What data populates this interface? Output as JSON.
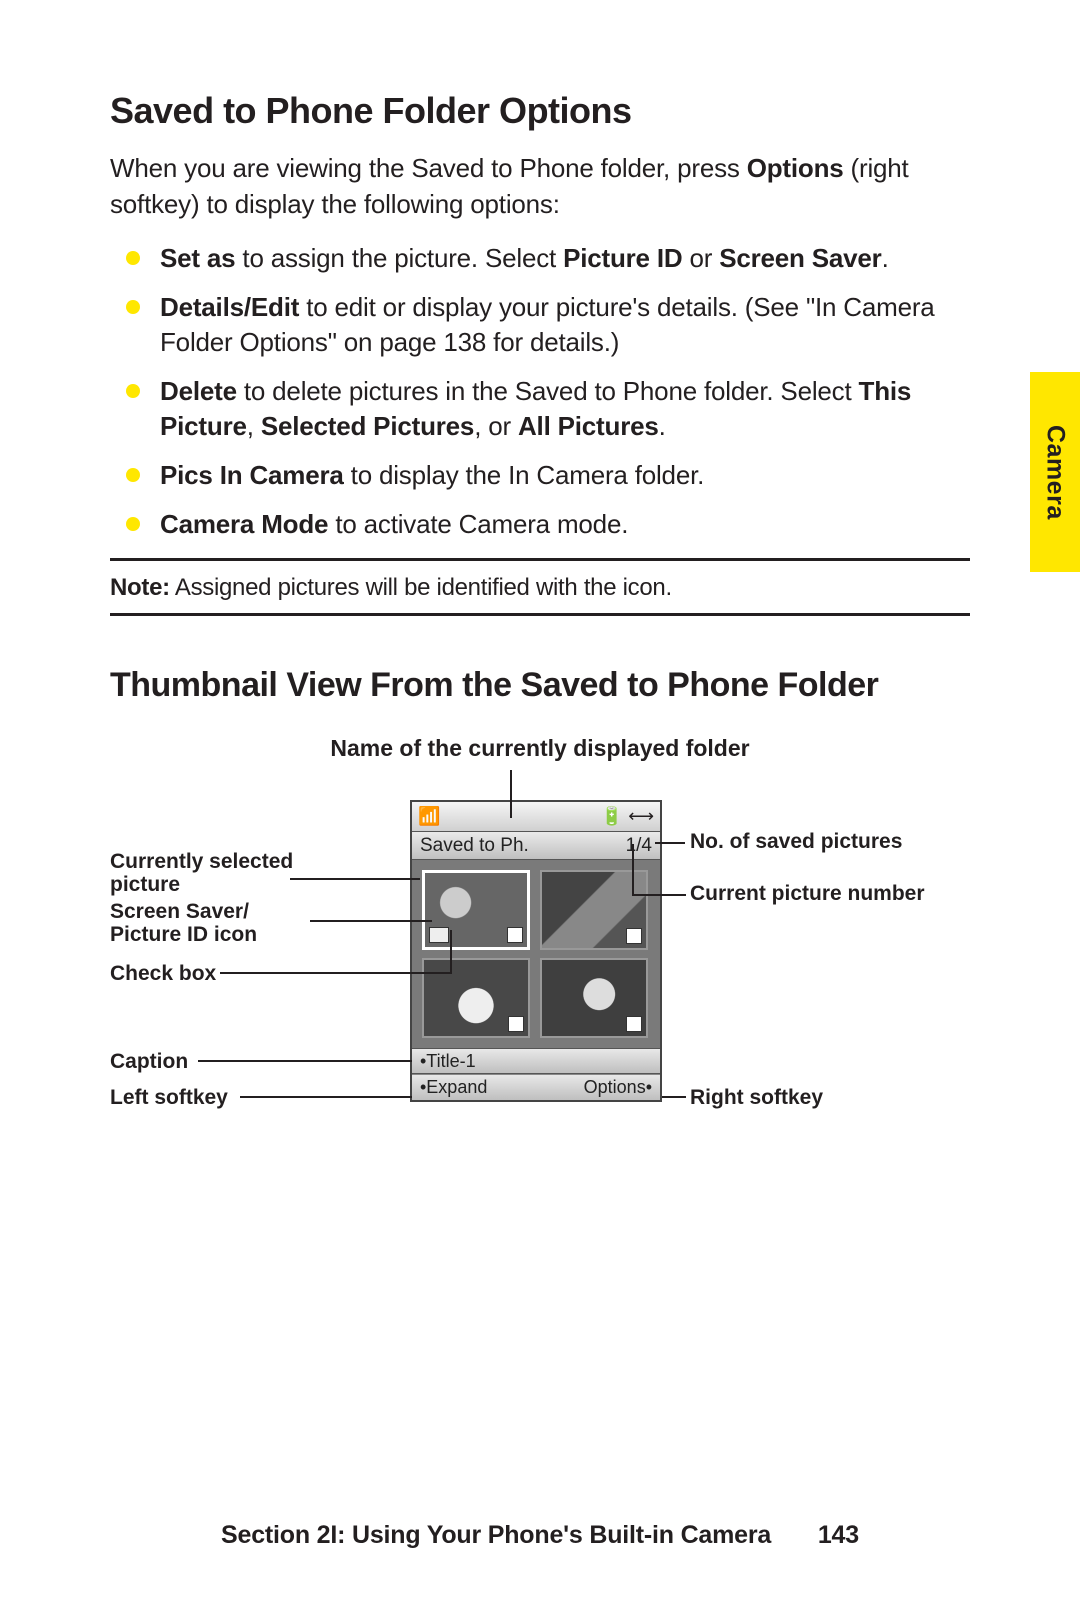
{
  "tab_label": "Camera",
  "heading1": "Saved to Phone Folder Options",
  "intro_pre": "When you are viewing the Saved to Phone folder, press ",
  "intro_bold": "Options",
  "intro_post": " (right softkey) to display the following options:",
  "bullets": [
    {
      "b1": "Set as",
      "t1": " to assign the picture. Select ",
      "b2": "Picture ID",
      "t2": " or ",
      "b3": "Screen Saver",
      "t3": "."
    },
    {
      "b1": "Details/Edit",
      "t1": " to edit or display your picture's details. (See \"In Camera Folder Options\" on page 138 for details.)"
    },
    {
      "b1": "Delete",
      "t1": " to delete pictures in the Saved to Phone folder. Select ",
      "b2": "This Picture",
      "t2": ", ",
      "b3": "Selected Pictures",
      "t3": ", or ",
      "b4": "All Pictures",
      "t4": "."
    },
    {
      "b1": "Pics In Camera",
      "t1": " to display the In Camera folder."
    },
    {
      "b1": "Camera Mode",
      "t1": " to activate Camera mode."
    }
  ],
  "note_label": "Note:",
  "note_text": " Assigned pictures will be identified with the icon.",
  "heading2": "Thumbnail View From the Saved to Phone Folder",
  "callout_top": "Name of the currently displayed folder",
  "labels_left": {
    "currently_selected": "Currently selected picture",
    "screen_saver_icon": "Screen Saver/ Picture ID icon",
    "check_box": "Check box",
    "caption": "Caption",
    "left_softkey": "Left softkey"
  },
  "labels_right": {
    "no_saved": "No. of saved pictures",
    "current_num": "Current picture number",
    "right_softkey": "Right softkey"
  },
  "phone": {
    "title": "Saved to Ph.",
    "counter": "1/4",
    "caption": "•Title-1",
    "left_soft": "•Expand",
    "right_soft": "Options•",
    "signal": "▮▮▮▯",
    "battery": "▣▢▢"
  },
  "footer_section": "Section 2I: Using Your Phone's Built-in Camera",
  "footer_page": "143"
}
